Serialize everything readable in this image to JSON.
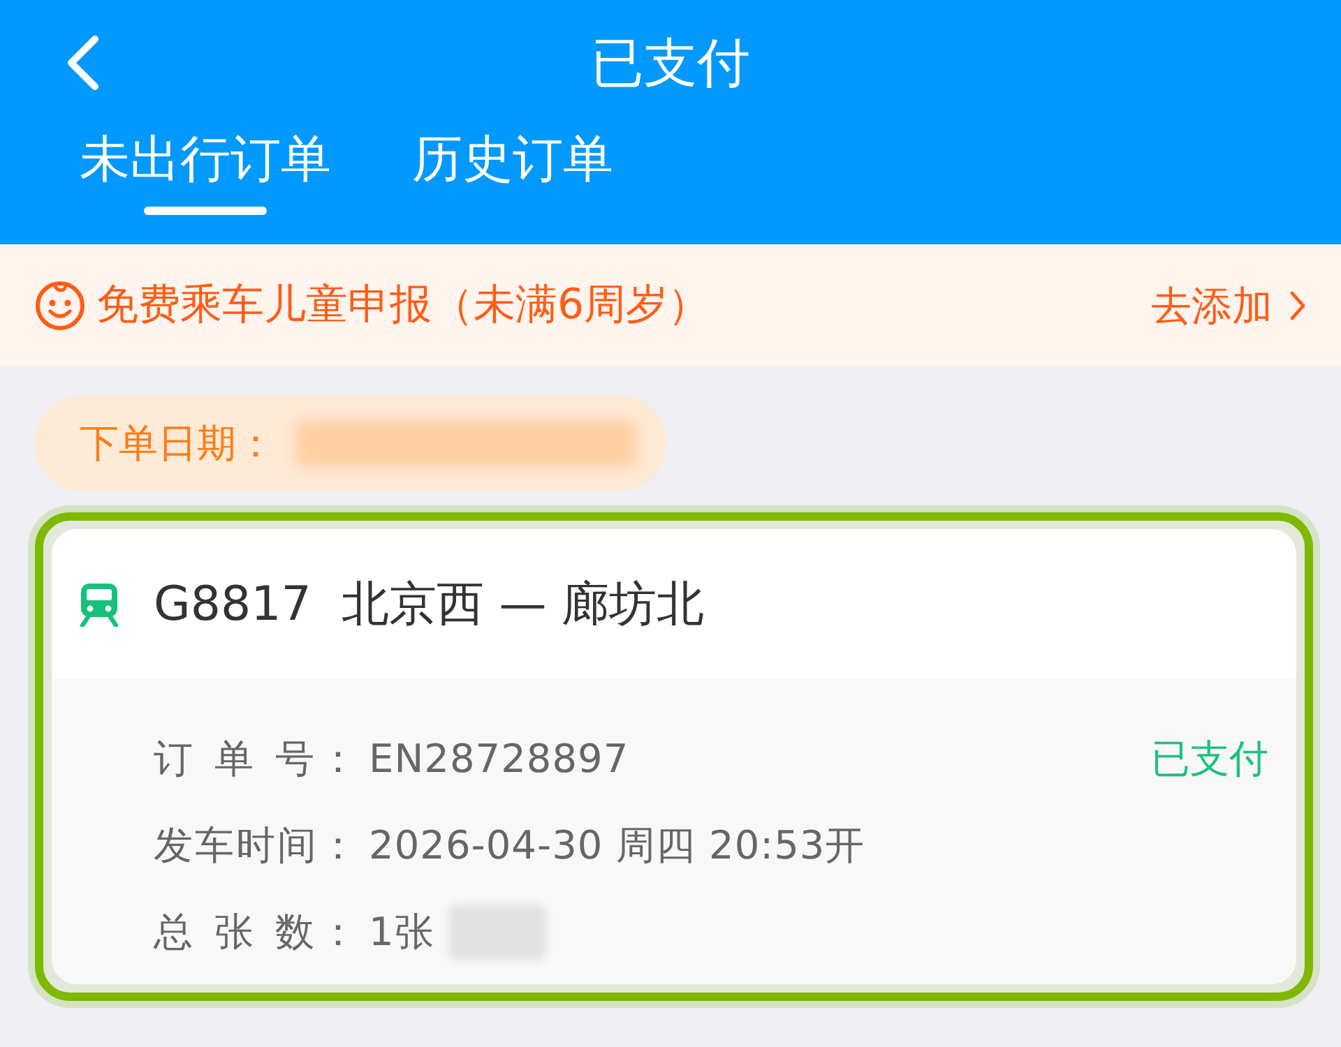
{
  "header": {
    "title": "已支付",
    "tabs": [
      {
        "label": "未出行订单",
        "selected": true
      },
      {
        "label": "历史订单",
        "selected": false
      }
    ]
  },
  "banner": {
    "text": "免费乘车儿童申报（未满6周岁）",
    "action": "去添加"
  },
  "order_date": {
    "label": "下单日期：",
    "redacted": true
  },
  "order": {
    "highlighted": true,
    "title": "G8817  北京西 — 廊坊北",
    "status": "已支付",
    "rows": [
      {
        "label": "订 单 号：",
        "value": "EN28728897"
      },
      {
        "label": "发车时间：",
        "value": "2026-04-30 周四 20:53开"
      },
      {
        "label": "总 张 数：",
        "value": "1张",
        "redacted": true
      }
    ]
  }
}
